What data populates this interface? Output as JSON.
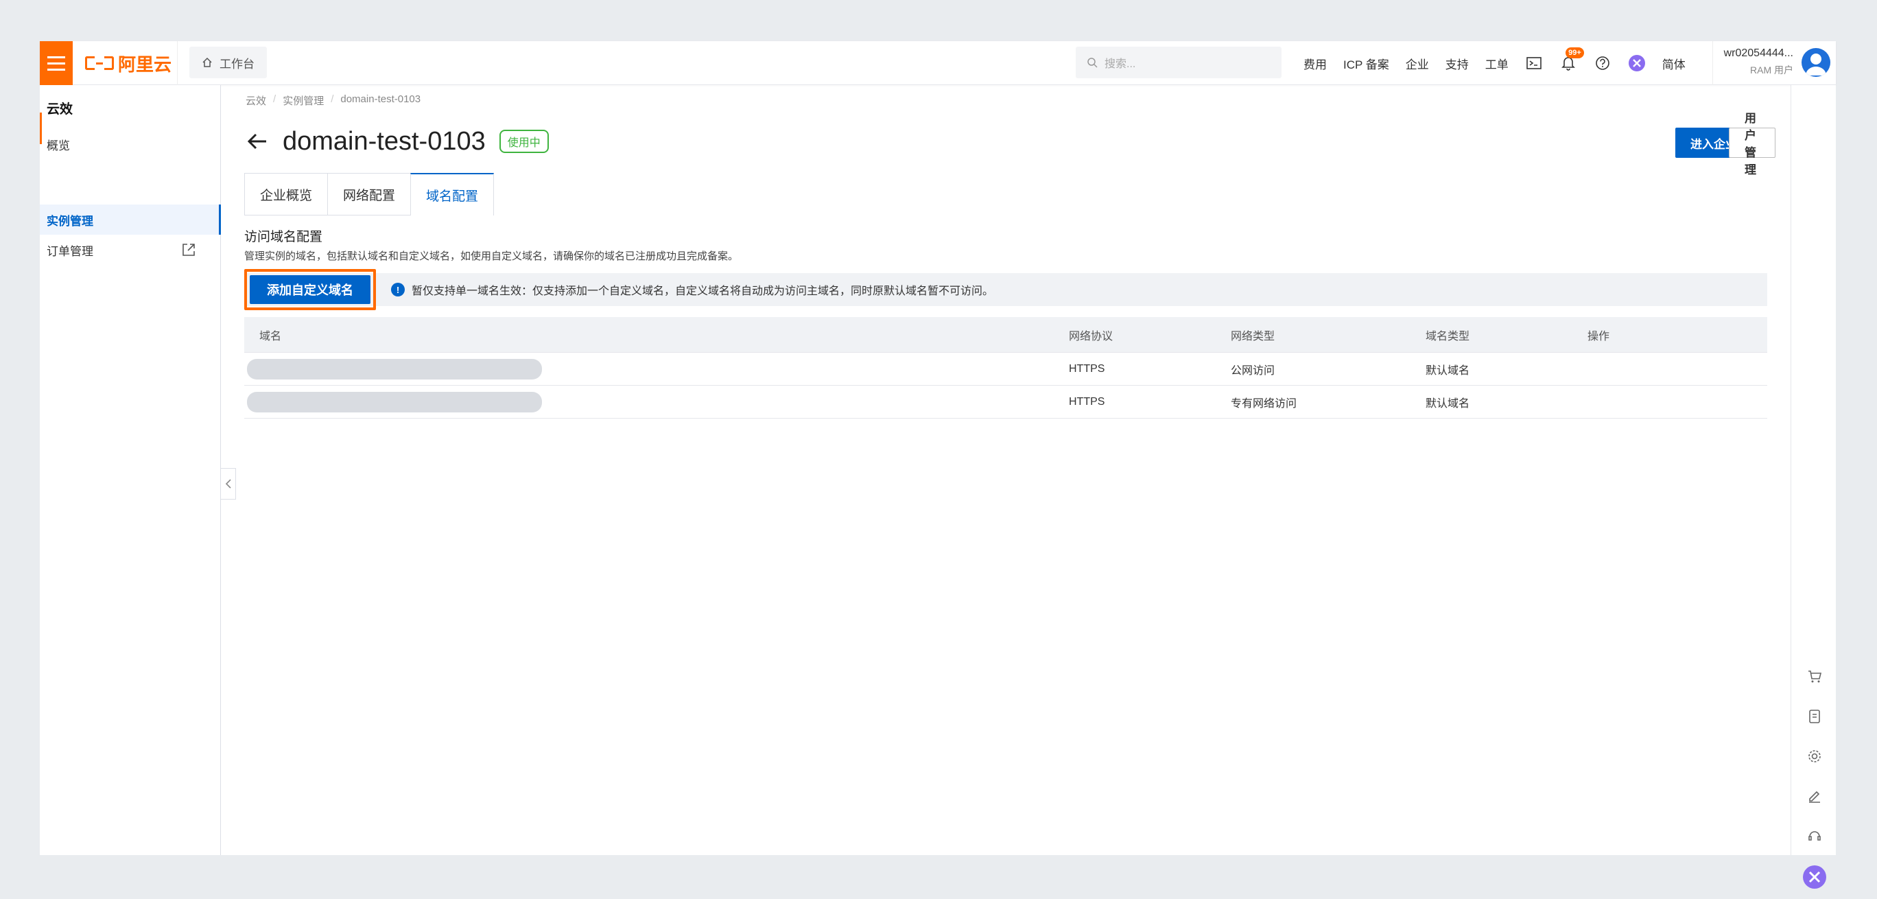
{
  "topbar": {
    "logo_text": "阿里云",
    "workbench_label": "工作台",
    "search_placeholder": "搜索...",
    "nav": [
      "费用",
      "ICP 备案",
      "企业",
      "支持",
      "工单"
    ],
    "notification_badge": "99+",
    "language": "简体",
    "user_name": "wr02054444...",
    "user_role": "RAM 用户",
    "brand_color": "#ff6a00"
  },
  "sidebar": {
    "title": "云效",
    "items": [
      {
        "label": "概览",
        "active": false
      },
      {
        "label": "实例管理",
        "active": true
      },
      {
        "label": "订单管理",
        "active": false,
        "external": true
      }
    ]
  },
  "breadcrumb": [
    "云效",
    "实例管理",
    "domain-test-0103"
  ],
  "page": {
    "title": "domain-test-0103",
    "status": "使用中",
    "enter_enterprise_button": "进入企业",
    "user_management_button": "用户管理"
  },
  "tabs": [
    {
      "label": "企业概览",
      "active": false
    },
    {
      "label": "网络配置",
      "active": false
    },
    {
      "label": "域名配置",
      "active": true
    }
  ],
  "section": {
    "title": "访问域名配置",
    "description": "管理实例的域名，包括默认域名和自定义域名，如使用自定义域名，请确保你的域名已注册成功且完成备案。",
    "add_button": "添加自定义域名",
    "notice": "暂仅支持单一域名生效：仅支持添加一个自定义域名，自定义域名将自动成为访问主域名，同时原默认域名暂不可访问。"
  },
  "table": {
    "columns": [
      "域名",
      "网络协议",
      "网络类型",
      "域名类型",
      "操作"
    ],
    "rows": [
      {
        "protocol": "HTTPS",
        "network": "公网访问",
        "type": "默认域名"
      },
      {
        "protocol": "HTTPS",
        "network": "专有网络访问",
        "type": "默认域名"
      }
    ]
  },
  "colors": {
    "primary": "#0064c8",
    "status_green": "#3fb43f",
    "highlight_orange": "#ff6a00"
  }
}
